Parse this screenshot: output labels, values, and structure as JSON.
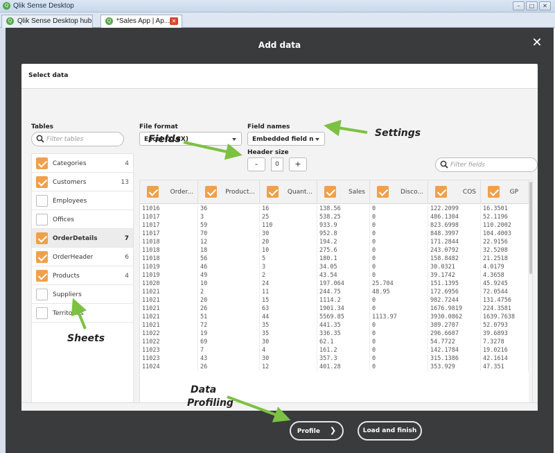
{
  "window": {
    "title": "Qlik Sense Desktop",
    "controls": [
      "–",
      "□",
      "✕"
    ]
  },
  "tabs": [
    {
      "label": "Qlik Sense Desktop hub",
      "active": false
    },
    {
      "label": "*Sales App | Ap...",
      "active": true
    }
  ],
  "dialog": {
    "title": "Add data",
    "close": "✕"
  },
  "panel": {
    "title": "Select data"
  },
  "tables": {
    "label": "Tables",
    "filter_placeholder": "Filter tables",
    "items": [
      {
        "name": "Categories",
        "count": "4",
        "checked": true,
        "selected": false
      },
      {
        "name": "Customers",
        "count": "13",
        "checked": true,
        "selected": false
      },
      {
        "name": "Employees",
        "count": "",
        "checked": false,
        "selected": false
      },
      {
        "name": "Offices",
        "count": "",
        "checked": false,
        "selected": false
      },
      {
        "name": "OrderDetails",
        "count": "7",
        "checked": true,
        "selected": true
      },
      {
        "name": "OrderHeader",
        "count": "6",
        "checked": true,
        "selected": false
      },
      {
        "name": "Products",
        "count": "4",
        "checked": true,
        "selected": false
      },
      {
        "name": "Suppliers",
        "count": "",
        "checked": false,
        "selected": false
      },
      {
        "name": "Territories",
        "count": "",
        "checked": false,
        "selected": false
      }
    ]
  },
  "settings": {
    "file_format_label": "File format",
    "file_format_value": "Excel (XLSX)",
    "field_names_label": "Field names",
    "field_names_value": "Embedded field na",
    "header_size_label": "Header size",
    "header_size_value": "0",
    "minus": "-",
    "plus": "+"
  },
  "fields_filter_placeholder": "Filter fields",
  "grid": {
    "columns": [
      "Order...",
      "Product...",
      "Quant...",
      "Sales",
      "Disco...",
      "COS",
      "GP"
    ],
    "rows": [
      [
        "11016",
        "36",
        "16",
        "138.56",
        "0",
        "122.2099",
        "16.3501"
      ],
      [
        "11017",
        "3",
        "25",
        "538.25",
        "0",
        "486.1304",
        "52.1196"
      ],
      [
        "11017",
        "59",
        "110",
        "933.9",
        "0",
        "823.6998",
        "110.2002"
      ],
      [
        "11017",
        "70",
        "30",
        "952.8",
        "0",
        "848.3997",
        "104.4003"
      ],
      [
        "11018",
        "12",
        "20",
        "194.2",
        "0",
        "171.2844",
        "22.9156"
      ],
      [
        "11018",
        "18",
        "10",
        "275.6",
        "0",
        "243.0792",
        "32.5208"
      ],
      [
        "11018",
        "56",
        "5",
        "180.1",
        "0",
        "158.8482",
        "21.2518"
      ],
      [
        "11019",
        "46",
        "3",
        "34.05",
        "0",
        "30.0321",
        "4.0179"
      ],
      [
        "11019",
        "49",
        "2",
        "43.54",
        "0",
        "39.1742",
        "4.3658"
      ],
      [
        "11020",
        "10",
        "24",
        "197.064",
        "25.704",
        "151.1395",
        "45.9245"
      ],
      [
        "11021",
        "2",
        "11",
        "244.75",
        "48.95",
        "172.6956",
        "72.0544"
      ],
      [
        "11021",
        "20",
        "15",
        "1114.2",
        "0",
        "982.7244",
        "131.4756"
      ],
      [
        "11021",
        "26",
        "63",
        "1901.34",
        "0",
        "1676.9819",
        "224.3581"
      ],
      [
        "11021",
        "51",
        "44",
        "5569.85",
        "1113.97",
        "3930.0862",
        "1639.7638"
      ],
      [
        "11021",
        "72",
        "35",
        "441.35",
        "0",
        "389.2707",
        "52.0793"
      ],
      [
        "11022",
        "19",
        "35",
        "336.35",
        "0",
        "296.6607",
        "39.6893"
      ],
      [
        "11022",
        "69",
        "30",
        "62.1",
        "0",
        "54.7722",
        "7.3278"
      ],
      [
        "11023",
        "7",
        "4",
        "161.2",
        "0",
        "142.1784",
        "19.0216"
      ],
      [
        "11023",
        "43",
        "30",
        "357.3",
        "0",
        "315.1386",
        "42.1614"
      ],
      [
        "11024",
        "26",
        "12",
        "401.28",
        "0",
        "353.929",
        "47.351"
      ]
    ]
  },
  "annotations": {
    "fields": "Fields",
    "settings": "Settings",
    "sheets": "Sheets",
    "profiling_line1": "Data",
    "profiling_line2": "Profiling"
  },
  "buttons": {
    "profile": "Profile",
    "profile_arrow": "❯",
    "load": "Load and finish"
  },
  "colors": {
    "accent": "#f0a04b",
    "arrow": "#7cc142",
    "backdrop": "#3a3b3c"
  }
}
